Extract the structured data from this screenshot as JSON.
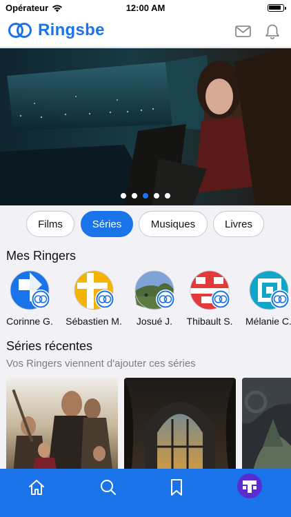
{
  "status_bar": {
    "carrier": "Opérateur",
    "time": "12:00 AM"
  },
  "header": {
    "app_name": "Ringsbe",
    "brand_color": "#1a73e8",
    "icons": [
      "mail-icon",
      "bell-icon"
    ]
  },
  "hero": {
    "slide_count": 5,
    "active_slide": 3
  },
  "category_tabs": [
    {
      "label": "Films",
      "active": false
    },
    {
      "label": "Séries",
      "active": true
    },
    {
      "label": "Musiques",
      "active": false
    },
    {
      "label": "Livres",
      "active": false
    }
  ],
  "ringers": {
    "title": "Mes Ringers",
    "items": [
      {
        "name": "Corinne G."
      },
      {
        "name": "Sébastien M."
      },
      {
        "name": "Josué J."
      },
      {
        "name": "Thibault S."
      },
      {
        "name": "Mélanie C."
      }
    ]
  },
  "recent_series": {
    "title": "Séries récentes",
    "subtitle": "Vos Ringers viennent d'ajouter ces séries"
  },
  "tab_bar": {
    "color": "#1a73e8",
    "items": [
      "home-icon",
      "search-icon",
      "bookmark-icon",
      "profile-icon"
    ]
  }
}
